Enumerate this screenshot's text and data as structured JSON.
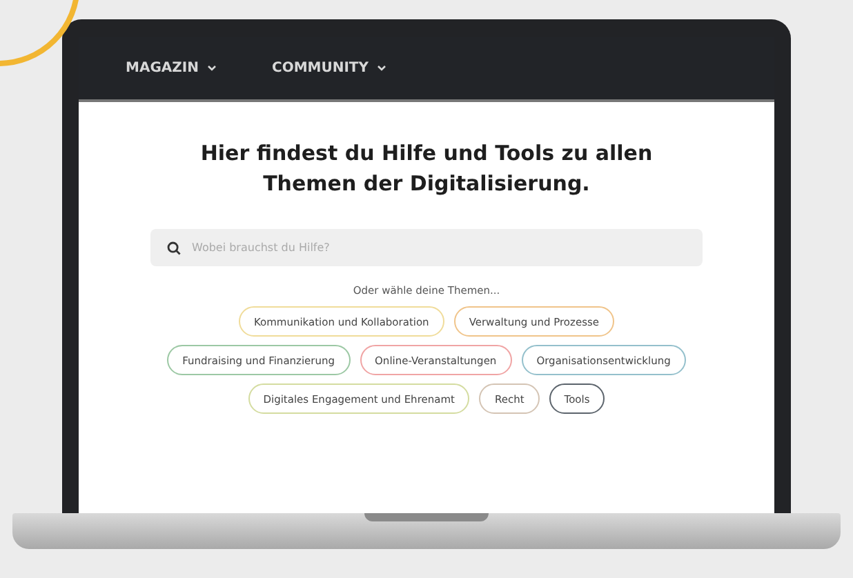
{
  "nav": {
    "items": [
      {
        "label": "MAGAZIN"
      },
      {
        "label": "COMMUNITY"
      }
    ]
  },
  "headline": [
    "Hier findest du Hilfe und Tools zu allen",
    "Themen der Digitalisierung."
  ],
  "search": {
    "placeholder": "Wobei brauchst du Hilfe?"
  },
  "topics_hint": "Oder wähle deine Themen...",
  "topic_rows": [
    [
      {
        "label": "Kommunikation und Kollaboration",
        "color": "#f0dc9a"
      },
      {
        "label": "Verwaltung und Prozesse",
        "color": "#f0c48a"
      }
    ],
    [
      {
        "label": "Fundraising und Finanzierung",
        "color": "#9cc8a4"
      },
      {
        "label": "Online-Veranstaltungen",
        "color": "#f0a4a4"
      },
      {
        "label": "Organisationsentwicklung",
        "color": "#94c0cc"
      }
    ],
    [
      {
        "label": "Digitales Engagement und Ehrenamt",
        "color": "#d4dca0"
      },
      {
        "label": "Recht",
        "color": "#d4c4b4"
      },
      {
        "label": "Tools",
        "color": "#5c646c"
      }
    ]
  ]
}
